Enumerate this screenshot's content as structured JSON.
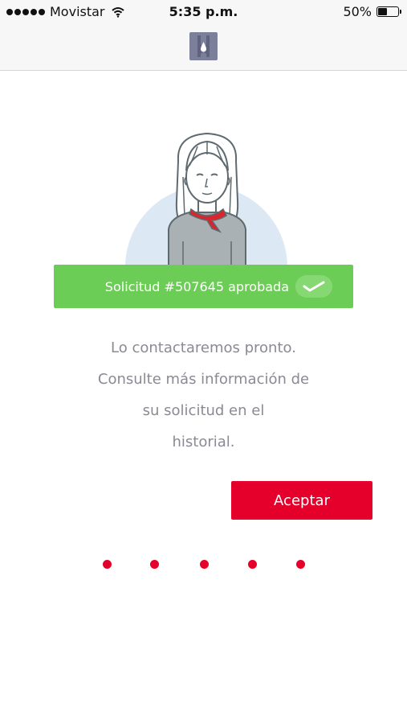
{
  "status_bar": {
    "carrier": "Movistar",
    "time": "5:35 p.m.",
    "battery_percent": "50%",
    "battery_level": 0.5,
    "signal_icon": "signal-dots-icon",
    "wifi_icon": "wifi-icon",
    "battery_icon": "battery-icon"
  },
  "nav": {
    "logo_icon": "bank-logo-icon"
  },
  "illustration": {
    "icon": "support-agent-illustration",
    "colors": {
      "circle": "#dce9f4",
      "scarf": "#d7262d",
      "shirt": "#a9b1b4",
      "line": "#5d6a70"
    }
  },
  "banner": {
    "text": "Solicitud #507645 aprobada",
    "icon": "checkmark-icon",
    "color": "#6ccd56"
  },
  "message": {
    "lines": [
      "Lo contactaremos pronto.",
      "Consulte más información de",
      "su solicitud en el",
      "historial."
    ]
  },
  "accept_button": {
    "label": "Aceptar",
    "color": "#e4002b"
  },
  "pagination": {
    "count": 5,
    "color": "#e4002b"
  }
}
